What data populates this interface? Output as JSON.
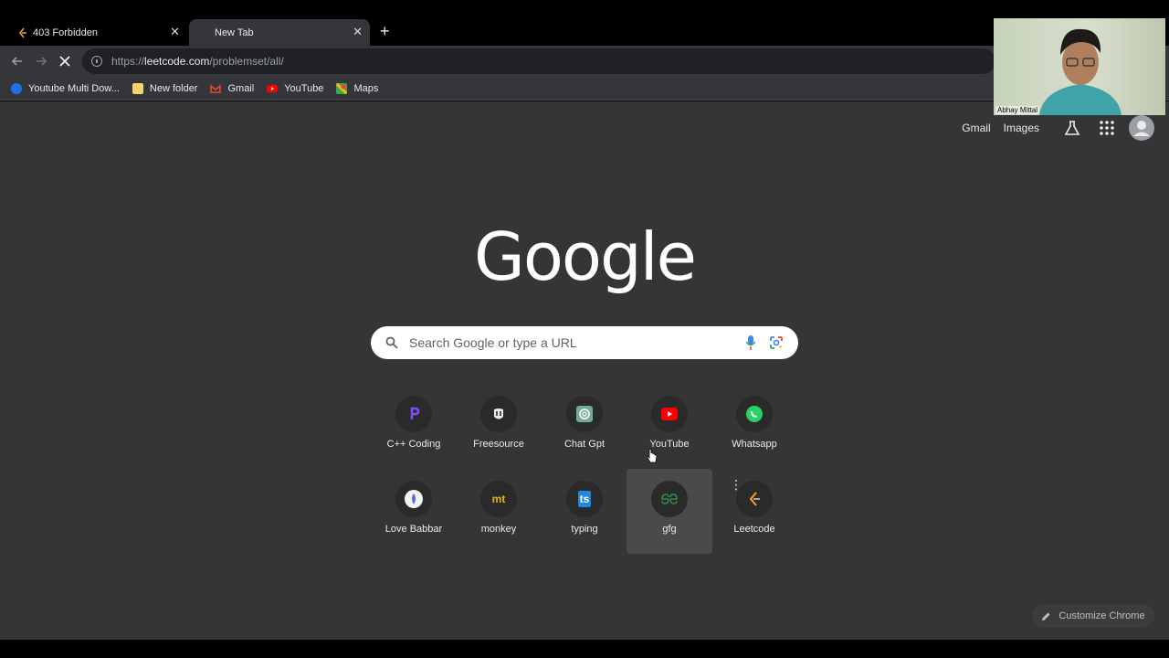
{
  "tabs": [
    {
      "title": "403 Forbidden",
      "active": false
    },
    {
      "title": "New Tab",
      "active": true
    }
  ],
  "toolbar": {
    "url_scheme": "https://",
    "url_host": "leetcode.com",
    "url_path": "/problemset/all/"
  },
  "bookmarks": [
    {
      "label": "Youtube Multi Dow...",
      "icon": "downloader-icon",
      "color": "#1a73e8"
    },
    {
      "label": "New folder",
      "icon": "folder-icon",
      "color": "#f6d36b"
    },
    {
      "label": "Gmail",
      "icon": "gmail-icon",
      "color": "#ea4335"
    },
    {
      "label": "YouTube",
      "icon": "youtube-icon",
      "color": "#ff0000"
    },
    {
      "label": "Maps",
      "icon": "maps-icon",
      "color": "#34a853"
    }
  ],
  "top_links": {
    "gmail": "Gmail",
    "images": "Images"
  },
  "logo": "Google",
  "search": {
    "placeholder": "Search Google or type a URL"
  },
  "shortcuts": [
    {
      "label": "C++ Coding",
      "icon": "cpp-coding-icon",
      "color": "#7c4dff"
    },
    {
      "label": "Freesource",
      "icon": "freesource-icon",
      "color": "#e8eaed"
    },
    {
      "label": "Chat Gpt",
      "icon": "chatgpt-icon",
      "color": "#74aa9c"
    },
    {
      "label": "YouTube",
      "icon": "youtube-icon",
      "color": "#ff0000"
    },
    {
      "label": "Whatsapp",
      "icon": "whatsapp-icon",
      "color": "#25d366"
    },
    {
      "label": "Love Babbar",
      "icon": "love-babbar-icon",
      "color": "#5b6bd6"
    },
    {
      "label": "monkey",
      "icon": "monkeytype-icon",
      "color": "#e2b714"
    },
    {
      "label": "typing",
      "icon": "typing-icon",
      "color": "#1e88e5"
    },
    {
      "label": "gfg",
      "icon": "gfg-icon",
      "color": "#2f8d46"
    },
    {
      "label": "Leetcode",
      "icon": "leetcode-icon",
      "color": "#ffa116"
    }
  ],
  "customize": {
    "label": "Customize Chrome"
  },
  "webcam": {
    "name": "Abhay Mittal"
  }
}
